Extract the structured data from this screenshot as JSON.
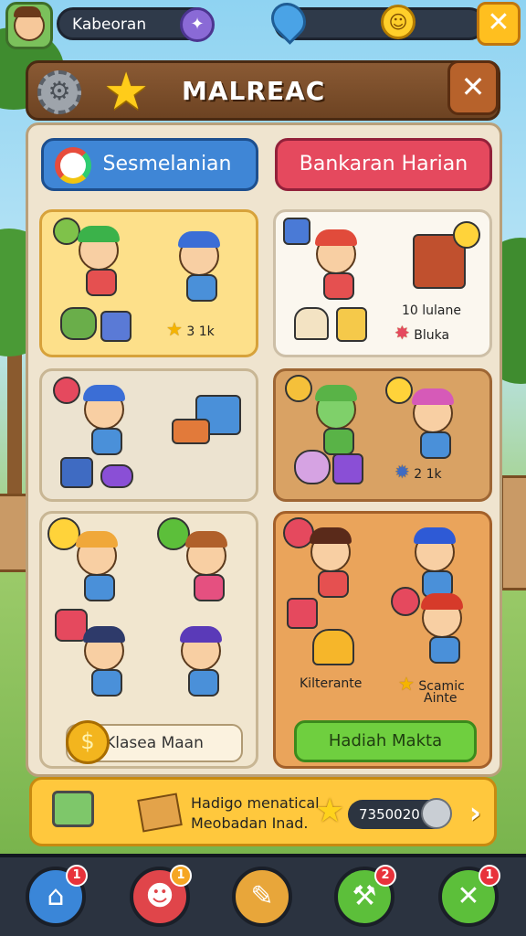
{
  "top_bar": {
    "player_name": "Kabeoran",
    "badge_icon": "compass-icon",
    "currency_icon": "map-pin-icon",
    "smile_icon": "smiley-coin-icon",
    "close_icon": "close-icon"
  },
  "panel": {
    "title": "MALREAC",
    "settings_icon": "gear-icon",
    "star_icon": "star-icon",
    "close_icon": "close-icon"
  },
  "tabs": [
    {
      "label": "Sesmelanian",
      "color": "#3f86d6"
    },
    {
      "label": "Bankaran Harian",
      "color": "#e5495e"
    }
  ],
  "cards": {
    "c1": {
      "value": "3 1k"
    },
    "c2": {
      "line1": "10 lulane",
      "line2": "Bluka"
    },
    "c4": {
      "value": "2 1k"
    },
    "c5": {
      "button": "Klasea Maan"
    },
    "c6": {
      "label_left": "Kilterante",
      "label_right_1": "Scamic",
      "label_right_2": "Ainte",
      "button": "Hadiah Makta"
    }
  },
  "promo": {
    "line1": "Hadigo menatical",
    "line2": "Meobadan Inad.",
    "counter": "7350020",
    "arrow": "›"
  },
  "nav": [
    {
      "name": "home",
      "icon": "house-icon",
      "badge": "1",
      "color": "#3a86d8"
    },
    {
      "name": "friends",
      "icon": "character-icon",
      "badge": "1",
      "color": "#e0454a"
    },
    {
      "name": "tools",
      "icon": "wrench-icon",
      "badge": "",
      "color": "#e8a63a"
    },
    {
      "name": "build",
      "icon": "hammer-icon",
      "badge": "2",
      "color": "#5cbf3a"
    },
    {
      "name": "battle",
      "icon": "crossed-swords-icon",
      "badge": "1",
      "color": "#5cbf3a"
    }
  ]
}
